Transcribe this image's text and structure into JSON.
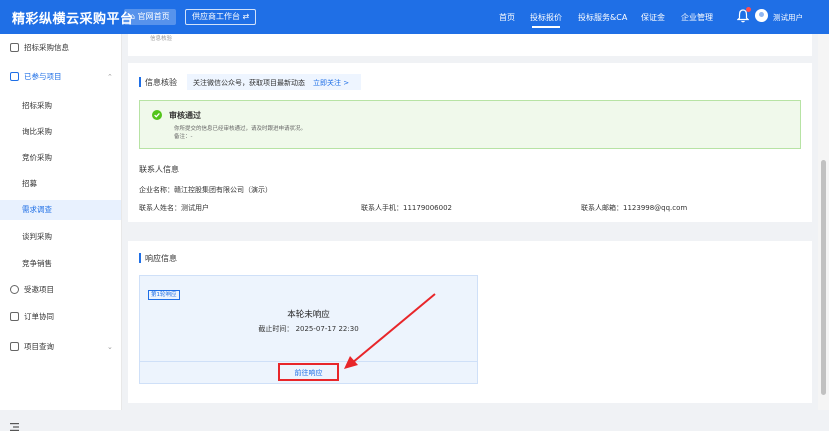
{
  "header": {
    "brand": "精彩纵横云采购平台",
    "home_btn": "官网首页",
    "workbench_btn": "供应商工作台 ⇄",
    "nav": [
      "首页",
      "投标报价",
      "投标服务&CA",
      "保证金",
      "企业管理"
    ],
    "username": "测试用户"
  },
  "sidebar": {
    "items": [
      {
        "label": "招标采购信息"
      },
      {
        "label": "已参与项目"
      },
      {
        "label": "招标采购"
      },
      {
        "label": "询比采购"
      },
      {
        "label": "竞价采购"
      },
      {
        "label": "招募"
      },
      {
        "label": "需求调查"
      },
      {
        "label": "谈判采购"
      },
      {
        "label": "竞争销售"
      },
      {
        "label": "受邀项目"
      },
      {
        "label": "订单协同"
      },
      {
        "label": "项目查询"
      }
    ]
  },
  "top_card": {
    "fragment": "信息核验"
  },
  "verify": {
    "title": "信息核验",
    "notice": "关注微信公众号，获取项目最新动态",
    "notice_link": "立即关注 >",
    "status_title": "审核通过",
    "status_desc": "你所提交的信息已经审核通过，请及时跟进申请状况。",
    "remark": "备注：-",
    "contact_title": "联系人信息",
    "company": "企业名称：赣江控股集团有限公司（演示）",
    "contact_name": "联系人姓名：测试用户",
    "contact_phone": "联系人手机：11179006002",
    "contact_email": "联系人邮箱：1123998@qq.com"
  },
  "response": {
    "title": "响应信息",
    "round_tag": "第1轮响应",
    "status": "本轮未响应",
    "deadline": "截止时间：  2025-07-17 22:30",
    "action": "前往响应"
  },
  "colors": {
    "primary": "#1f6fe6",
    "success_bg": "#f0f9eb",
    "success_border": "#b7e3a4",
    "success_icon": "#52c41a",
    "annotation_red": "#e8262a",
    "response_box_bg": "#edf4fd"
  }
}
